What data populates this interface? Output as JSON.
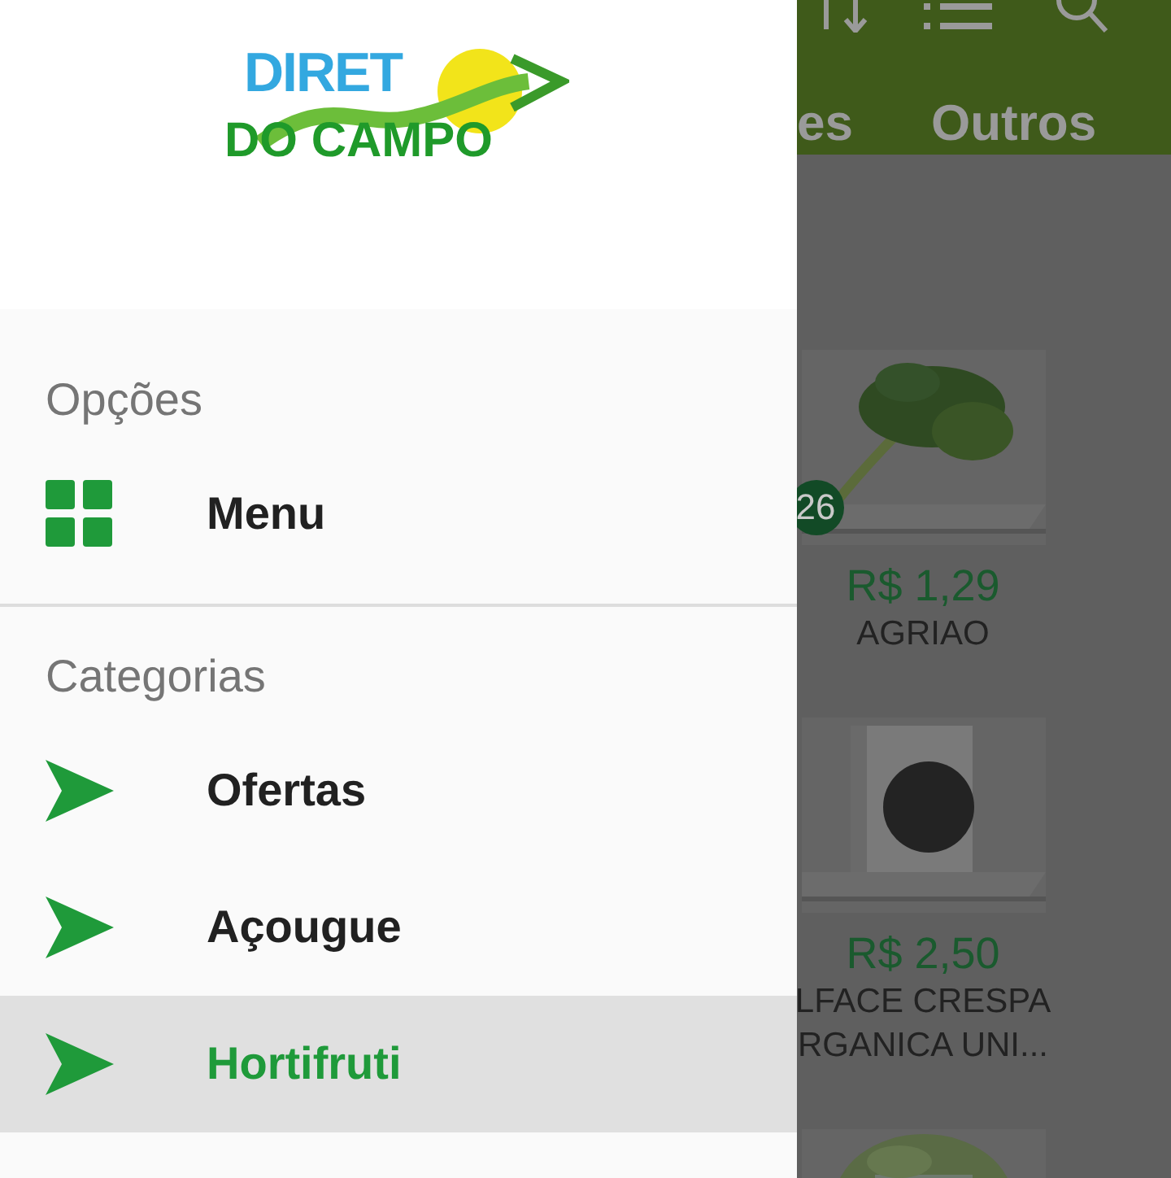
{
  "app": {
    "tabs": [
      {
        "label": "es",
        "selected": false
      },
      {
        "label": "Outros",
        "selected": false
      }
    ],
    "products": [
      {
        "kind": "picture",
        "badge": "26",
        "price": "R$ 1,29",
        "name_lines": [
          "AGRIAO"
        ]
      },
      {
        "kind": "picture",
        "price": "R$ 2,50",
        "name_lines": [
          "LFACE CRESPA",
          "RGANICA UNI..."
        ]
      },
      {
        "kind": "picture"
      }
    ]
  },
  "drawer": {
    "logo": {
      "top": "DIRET",
      "bottom": "DO CAMPO"
    },
    "sections": [
      {
        "title": "Opções",
        "items": [
          {
            "label": "Menu",
            "kind": "grid",
            "selected": false
          }
        ]
      },
      {
        "title": "Categorias",
        "items": [
          {
            "label": "Ofertas",
            "kind": "arrow",
            "selected": false
          },
          {
            "label": "Açougue",
            "kind": "arrow",
            "selected": false
          },
          {
            "label": "Hortifruti",
            "kind": "arrow",
            "selected": true
          }
        ]
      }
    ]
  }
}
